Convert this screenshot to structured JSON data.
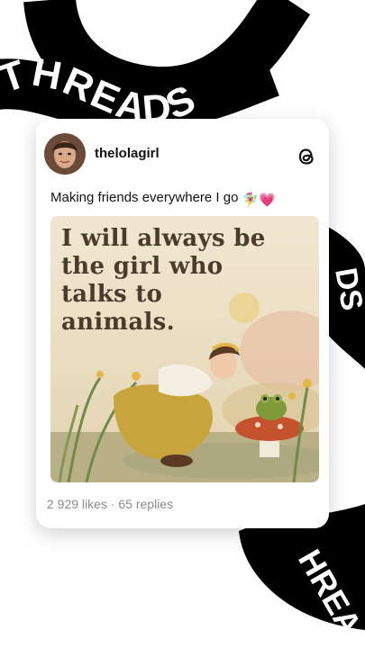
{
  "brand_ribbon_text": "THREADS",
  "post": {
    "username": "thelolagirl",
    "caption": "Making friends everywhere I go",
    "caption_emojis": "🧚‍♀️💗",
    "image_quote_lines": [
      "I will always be",
      "the girl who",
      "talks to",
      "animals."
    ],
    "likes": "2 929 likes",
    "separator": "·",
    "replies": "65 replies"
  },
  "icons": {
    "threads_logo": "threads-logo-icon",
    "avatar": "profile-photo"
  },
  "colors": {
    "ribbon": "#000000",
    "ribbon_text": "#ffffff",
    "card_bg": "#ffffff",
    "text_primary": "#111111",
    "text_secondary": "#8a8a8a",
    "quote_text": "#4a3b2c"
  }
}
